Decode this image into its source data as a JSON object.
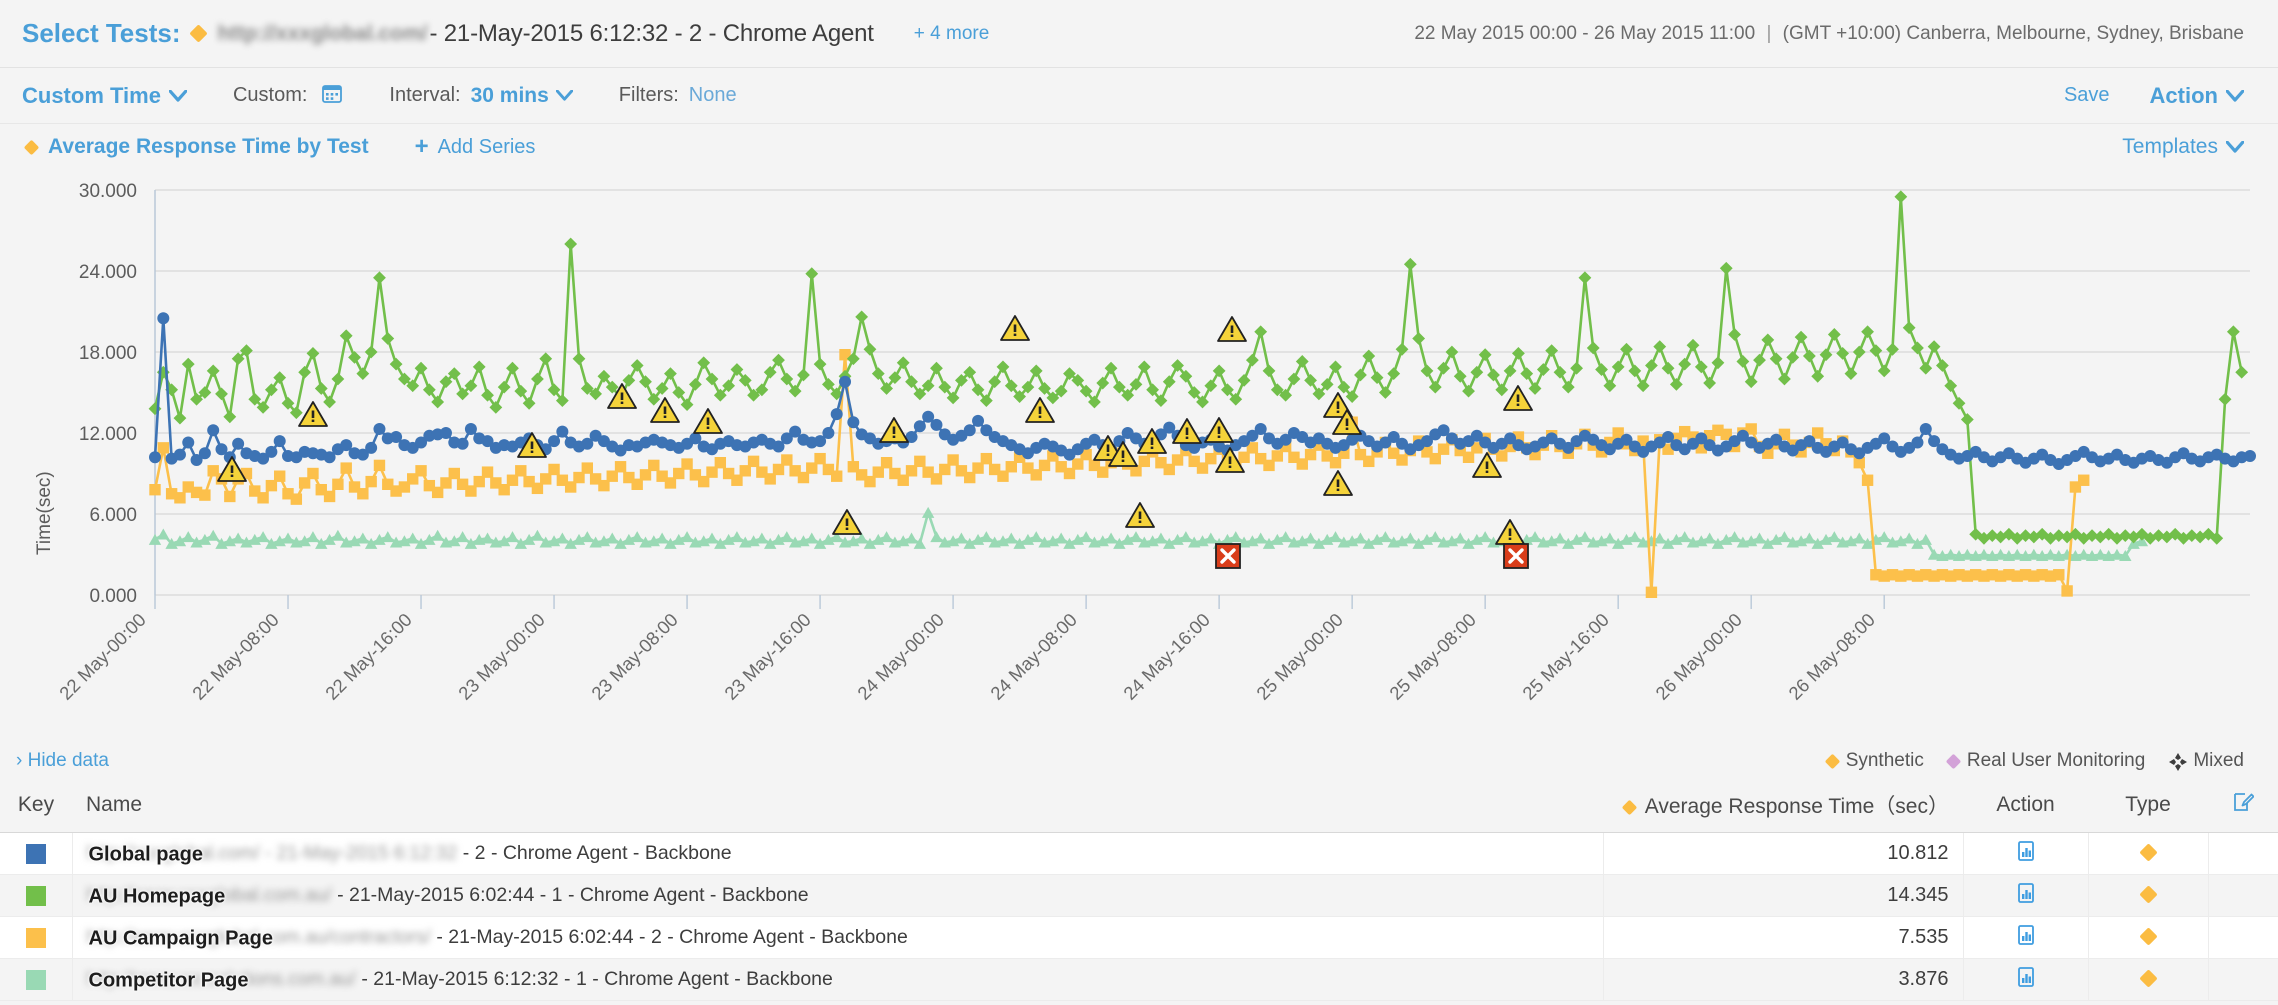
{
  "header": {
    "select_tests_label": "Select Tests:",
    "blurred_url": "http://xxxglobal.com/",
    "title": "- 21-May-2015 6:12:32 - 2 - Chrome Agent",
    "more_link": "+ 4 more",
    "date_range": "22 May 2015 00:00 - 26 May 2015 11:00",
    "separator": "|",
    "timezone": "(GMT +10:00) Canberra, Melbourne, Sydney, Brisbane"
  },
  "toolbar": {
    "time_mode": "Custom Time",
    "custom_label": "Custom:",
    "calendar_icon": "calendar-icon",
    "interval_label": "Interval:",
    "interval_value": "30 mins",
    "filters_label": "Filters:",
    "filters_value": "None",
    "save_label": "Save",
    "action_label": "Action",
    "caret": "⌄"
  },
  "series_bar": {
    "series_name": "Average Response Time by Test",
    "add_series": "Add Series",
    "templates": "Templates"
  },
  "chart_data": {
    "type": "line",
    "title": "Average Response Time by Test",
    "xlabel": "",
    "ylabel": "Time(sec)",
    "ylim": [
      0,
      30
    ],
    "yticks": [
      "0.000",
      "6.000",
      "12.000",
      "18.000",
      "24.000",
      "30.000"
    ],
    "grid": true,
    "legend_position": "below-table",
    "xticks": [
      "22 May-00:00",
      "22 May-08:00",
      "22 May-16:00",
      "23 May-00:00",
      "23 May-08:00",
      "23 May-16:00",
      "24 May-00:00",
      "24 May-08:00",
      "24 May-16:00",
      "25 May-00:00",
      "25 May-08:00",
      "25 May-16:00",
      "26 May-00:00",
      "26 May-08:00"
    ],
    "x_start": "22 May 2015 00:00",
    "x_end": "26 May 2015 11:00",
    "interval": "30 mins",
    "series": [
      {
        "name": "Global page",
        "color": "#3d73b4",
        "marker": "circle",
        "average": 10.812,
        "values": [
          10.2,
          20.5,
          10.1,
          10.4,
          11.3,
          10.0,
          10.5,
          12.2,
          10.8,
          10.2,
          11.2,
          10.5,
          10.3,
          10.1,
          10.6,
          11.4,
          10.3,
          10.2,
          10.6,
          10.5,
          10.4,
          10.2,
          10.8,
          11.1,
          10.5,
          10.4,
          10.9,
          12.3,
          11.6,
          11.7,
          11.1,
          10.9,
          11.3,
          11.8,
          11.9,
          12.0,
          11.3,
          11.2,
          12.3,
          11.6,
          11.4,
          10.9,
          11.1,
          11.0,
          11.3,
          11.6,
          11.1,
          10.8,
          11.4,
          12.1,
          11.3,
          11.0,
          11.2,
          11.8,
          11.4,
          11.0,
          10.7,
          11.1,
          11.0,
          11.3,
          11.5,
          11.3,
          11.1,
          10.9,
          11.2,
          11.6,
          11.0,
          10.8,
          11.2,
          11.4,
          11.1,
          11.0,
          11.3,
          11.5,
          11.2,
          11.0,
          11.6,
          12.1,
          11.5,
          11.3,
          11.4,
          12.0,
          13.4,
          15.8,
          12.8,
          11.9,
          11.6,
          11.2,
          11.4,
          11.6,
          11.3,
          11.7,
          12.5,
          13.2,
          12.6,
          11.9,
          11.5,
          11.8,
          12.2,
          12.9,
          12.2,
          11.7,
          11.4,
          11.1,
          10.8,
          10.5,
          10.9,
          11.2,
          11.0,
          10.7,
          10.4,
          10.8,
          11.2,
          11.5,
          11.1,
          10.8,
          11.4,
          12.0,
          11.6,
          11.2,
          11.5,
          11.9,
          12.4,
          11.8,
          11.1,
          10.9,
          11.3,
          11.5,
          11.0,
          10.7,
          11.1,
          11.4,
          11.8,
          12.3,
          11.6,
          11.2,
          11.5,
          12.0,
          11.7,
          11.3,
          11.6,
          11.2,
          10.9,
          11.1,
          11.5,
          11.8,
          11.4,
          11.0,
          11.3,
          11.7,
          11.2,
          10.8,
          11.1,
          11.4,
          11.9,
          12.2,
          11.6,
          11.2,
          11.4,
          11.8,
          11.3,
          10.9,
          11.2,
          11.6,
          11.1,
          10.8,
          11.0,
          11.3,
          11.6,
          11.2,
          10.9,
          11.4,
          11.8,
          11.5,
          11.1,
          10.8,
          11.2,
          11.5,
          11.0,
          10.6,
          11.0,
          11.3,
          11.7,
          11.1,
          10.8,
          11.2,
          11.6,
          11.1,
          10.7,
          11.0,
          11.4,
          11.8,
          11.3,
          10.9,
          11.2,
          11.5,
          11.0,
          10.7,
          11.1,
          11.4,
          10.9,
          10.6,
          11.0,
          11.3,
          10.8,
          10.5,
          10.9,
          11.2,
          11.6,
          11.0,
          10.6,
          10.9,
          11.3,
          12.3,
          11.4,
          10.8,
          10.4,
          10.1,
          10.3,
          10.6,
          10.2,
          9.9,
          10.2,
          10.5,
          10.1,
          9.8,
          10.1,
          10.4,
          10.0,
          9.7,
          10.0,
          10.3,
          10.6,
          10.2,
          9.9,
          10.1,
          10.4,
          10.0,
          9.8,
          10.1,
          10.3,
          10.0,
          9.8,
          10.2,
          10.5,
          10.1,
          9.9,
          10.2,
          10.4,
          10.1,
          9.9,
          10.2,
          10.3
        ]
      },
      {
        "name": "AU Homepage",
        "color": "#72bf4a",
        "marker": "diamond",
        "average": 14.345,
        "values": [
          13.8,
          16.5,
          15.2,
          13.1,
          17.1,
          14.5,
          15.0,
          16.6,
          14.9,
          13.2,
          17.5,
          18.1,
          14.5,
          13.9,
          15.2,
          16.1,
          14.2,
          13.5,
          16.5,
          17.9,
          15.3,
          14.3,
          16.0,
          19.2,
          17.6,
          16.4,
          18.0,
          23.5,
          19.0,
          17.1,
          16.0,
          15.5,
          16.8,
          15.2,
          14.3,
          15.8,
          16.4,
          14.9,
          15.5,
          16.9,
          14.8,
          13.9,
          15.4,
          16.8,
          15.1,
          14.2,
          16.0,
          17.5,
          15.2,
          14.4,
          26.0,
          17.5,
          15.3,
          14.9,
          16.2,
          15.4,
          14.6,
          15.9,
          17.0,
          15.8,
          14.5,
          15.3,
          16.4,
          15.0,
          14.1,
          15.6,
          17.2,
          16.0,
          14.8,
          15.5,
          16.7,
          15.9,
          14.8,
          15.2,
          16.5,
          17.4,
          16.0,
          15.1,
          16.3,
          23.8,
          17.1,
          15.6,
          14.9,
          16.2,
          17.5,
          20.6,
          18.2,
          16.4,
          15.3,
          16.1,
          17.2,
          15.8,
          14.9,
          15.5,
          16.8,
          15.4,
          14.6,
          15.9,
          16.5,
          15.2,
          14.4,
          15.8,
          16.9,
          15.5,
          14.7,
          15.4,
          16.6,
          15.3,
          14.6,
          15.1,
          16.4,
          15.9,
          15.1,
          14.3,
          15.7,
          16.8,
          15.4,
          14.8,
          15.6,
          16.9,
          15.2,
          14.4,
          15.8,
          17.0,
          16.2,
          15.0,
          14.3,
          15.5,
          16.6,
          15.2,
          14.5,
          15.9,
          17.4,
          19.5,
          16.6,
          15.2,
          14.8,
          16.0,
          17.3,
          15.9,
          14.9,
          15.6,
          16.9,
          15.4,
          14.7,
          16.3,
          17.7,
          16.1,
          15.0,
          16.4,
          18.2,
          24.5,
          19.0,
          16.6,
          15.4,
          16.8,
          18.0,
          16.2,
          15.1,
          16.5,
          17.8,
          16.3,
          15.2,
          16.6,
          17.9,
          16.4,
          15.3,
          16.7,
          18.1,
          16.5,
          15.4,
          16.8,
          23.5,
          18.3,
          16.7,
          15.5,
          16.9,
          18.2,
          16.6,
          15.5,
          17.0,
          18.4,
          16.8,
          15.6,
          17.1,
          18.5,
          16.9,
          15.7,
          17.2,
          24.2,
          19.3,
          17.3,
          15.8,
          17.4,
          18.9,
          17.5,
          16.0,
          17.6,
          19.1,
          17.7,
          16.2,
          17.8,
          19.3,
          17.9,
          16.4,
          18.0,
          19.5,
          18.1,
          16.6,
          18.2,
          29.5,
          19.8,
          18.3,
          16.8,
          18.4,
          17.0,
          15.5,
          14.2,
          13.0,
          4.5,
          4.2,
          4.4,
          4.3,
          4.5,
          4.2,
          4.4,
          4.3,
          4.5,
          4.2,
          4.4,
          4.3,
          4.5,
          4.2,
          4.4,
          4.3,
          4.5,
          4.2,
          4.4,
          4.3,
          4.5,
          4.2,
          4.4,
          4.3,
          4.5,
          4.2,
          4.4,
          4.3,
          4.5,
          4.2,
          14.5,
          19.5,
          16.5
        ]
      },
      {
        "name": "AU Campaign Page",
        "color": "#fcc04b",
        "marker": "square",
        "average": 7.535,
        "values": [
          7.8,
          10.9,
          7.5,
          7.2,
          8.0,
          7.6,
          7.4,
          9.2,
          8.6,
          7.3,
          8.6,
          9.0,
          7.7,
          7.2,
          8.1,
          8.8,
          7.5,
          7.1,
          8.3,
          9.0,
          7.8,
          7.3,
          8.2,
          9.4,
          8.0,
          7.5,
          8.4,
          9.6,
          8.2,
          7.7,
          8.0,
          8.6,
          9.2,
          8.1,
          7.6,
          8.3,
          9.0,
          8.2,
          7.7,
          8.4,
          9.1,
          8.3,
          7.8,
          8.5,
          9.2,
          8.4,
          7.9,
          8.6,
          9.3,
          8.5,
          8.0,
          8.7,
          9.4,
          8.6,
          8.1,
          8.8,
          9.5,
          8.7,
          8.2,
          8.9,
          9.6,
          8.8,
          8.3,
          9.0,
          9.7,
          8.9,
          8.4,
          9.1,
          9.8,
          9.0,
          8.5,
          9.2,
          9.9,
          9.1,
          8.6,
          9.3,
          10.0,
          9.2,
          8.7,
          9.4,
          10.1,
          9.3,
          8.8,
          17.8,
          9.5,
          8.9,
          8.4,
          9.1,
          9.8,
          9.0,
          8.5,
          9.2,
          9.9,
          9.1,
          8.6,
          9.3,
          10.0,
          9.2,
          8.7,
          9.4,
          10.1,
          9.3,
          8.8,
          9.5,
          10.2,
          9.4,
          8.9,
          9.6,
          10.3,
          9.5,
          9.0,
          9.7,
          10.4,
          9.6,
          9.1,
          9.8,
          10.5,
          9.7,
          9.2,
          9.9,
          10.6,
          9.8,
          9.3,
          10.0,
          10.7,
          9.9,
          9.4,
          10.1,
          10.8,
          10.0,
          9.5,
          10.2,
          10.9,
          10.1,
          9.6,
          10.3,
          11.0,
          10.2,
          9.7,
          10.4,
          11.1,
          10.3,
          9.8,
          10.5,
          12.8,
          10.4,
          9.9,
          10.6,
          11.3,
          10.5,
          10.0,
          10.7,
          11.4,
          10.6,
          10.1,
          10.8,
          11.5,
          10.7,
          10.2,
          10.9,
          11.6,
          10.8,
          10.3,
          11.0,
          11.7,
          10.9,
          10.4,
          11.1,
          11.8,
          11.0,
          10.5,
          11.2,
          11.9,
          11.1,
          10.6,
          11.3,
          12.0,
          11.2,
          10.7,
          11.4,
          0.2,
          11.5,
          10.8,
          11.6,
          12.1,
          11.7,
          10.9,
          11.8,
          12.2,
          11.9,
          11.0,
          12.0,
          12.3,
          11.0,
          10.5,
          11.2,
          11.9,
          11.1,
          10.6,
          11.3,
          12.0,
          11.2,
          10.7,
          11.4,
          10.6,
          9.8,
          8.5,
          1.5,
          1.4,
          1.5,
          1.4,
          1.5,
          1.4,
          1.5,
          1.4,
          1.5,
          1.4,
          1.5,
          1.4,
          1.5,
          1.4,
          1.5,
          1.4,
          1.5,
          1.4,
          1.5,
          1.4,
          1.5,
          1.4,
          1.5,
          0.3,
          8.0,
          8.5
        ]
      },
      {
        "name": "Competitor Page",
        "color": "#99d9b4",
        "marker": "triangle",
        "average": 3.876,
        "values": [
          4.1,
          4.5,
          3.8,
          4.0,
          4.3,
          3.9,
          4.1,
          4.4,
          3.8,
          4.0,
          4.2,
          3.9,
          4.1,
          4.3,
          3.8,
          4.0,
          4.2,
          3.9,
          4.0,
          4.3,
          3.8,
          4.1,
          4.4,
          3.9,
          4.0,
          4.2,
          3.8,
          4.1,
          4.3,
          3.9,
          4.0,
          4.2,
          3.8,
          4.1,
          4.4,
          3.9,
          4.0,
          4.3,
          3.8,
          4.1,
          4.2,
          3.9,
          4.0,
          4.3,
          3.8,
          4.1,
          4.4,
          3.9,
          4.0,
          4.2,
          3.8,
          4.1,
          4.3,
          3.9,
          4.0,
          4.2,
          3.8,
          4.1,
          4.3,
          3.9,
          4.0,
          4.2,
          3.8,
          4.1,
          4.3,
          3.9,
          4.0,
          4.2,
          3.8,
          4.1,
          4.3,
          3.9,
          4.0,
          4.2,
          3.8,
          4.1,
          4.3,
          3.9,
          4.0,
          4.2,
          3.8,
          4.1,
          4.3,
          3.9,
          4.0,
          4.2,
          3.8,
          4.1,
          4.3,
          3.9,
          4.0,
          4.2,
          3.8,
          6.1,
          4.3,
          3.9,
          4.0,
          4.2,
          3.8,
          4.1,
          4.3,
          3.9,
          4.0,
          4.2,
          3.8,
          4.1,
          4.3,
          3.9,
          4.0,
          4.2,
          3.8,
          4.1,
          4.3,
          3.9,
          4.0,
          4.2,
          3.8,
          4.1,
          4.3,
          3.9,
          4.0,
          4.2,
          3.8,
          4.1,
          4.3,
          3.9,
          4.0,
          4.2,
          3.8,
          4.1,
          4.3,
          3.9,
          4.0,
          4.2,
          3.8,
          4.1,
          4.3,
          3.9,
          4.0,
          4.2,
          3.8,
          4.1,
          4.3,
          3.9,
          4.0,
          4.2,
          3.8,
          4.1,
          4.3,
          3.9,
          4.0,
          4.2,
          3.8,
          4.1,
          4.3,
          3.9,
          4.0,
          4.2,
          3.8,
          4.1,
          4.3,
          3.9,
          4.0,
          4.2,
          3.8,
          4.1,
          4.3,
          3.9,
          4.0,
          4.2,
          3.8,
          4.1,
          4.3,
          3.9,
          4.0,
          4.2,
          3.8,
          4.1,
          4.3,
          3.9,
          4.0,
          4.2,
          3.8,
          4.1,
          4.3,
          3.9,
          4.0,
          4.2,
          3.8,
          4.1,
          4.3,
          3.9,
          4.0,
          4.2,
          3.8,
          4.1,
          4.3,
          3.9,
          4.0,
          4.2,
          3.8,
          4.1,
          4.3,
          3.9,
          4.0,
          4.2,
          3.8,
          4.1,
          4.3,
          3.9,
          4.0,
          4.2,
          3.8,
          4.1,
          3.0,
          2.9,
          3.0,
          2.9,
          3.0,
          2.9,
          3.0,
          2.9,
          3.0,
          2.9,
          3.0,
          2.9,
          3.0,
          2.9,
          3.0,
          2.9,
          3.0,
          2.9,
          3.0,
          2.9,
          3.0,
          2.9,
          3.0,
          2.9,
          3.8,
          4.0
        ]
      }
    ],
    "annotations": {
      "warning_icon": "warning-triangle-icon",
      "error_icon": "error-x-icon",
      "warning_count": 22,
      "error_count": 2
    }
  },
  "below_chart": {
    "hide_data": "› Hide data",
    "legend": [
      {
        "label": "Synthetic",
        "icon": "synthetic-diamond-icon",
        "color": "#fbbc42"
      },
      {
        "label": "Real User Monitoring",
        "icon": "rum-diamond-icon",
        "color": "#d3a2d8"
      },
      {
        "label": "Mixed",
        "icon": "mixed-icon",
        "color": "#3d3d3d"
      }
    ]
  },
  "table": {
    "columns": [
      "Key",
      "Name",
      "Average Response Time（sec）",
      "Action",
      "Type",
      ""
    ],
    "edit_icon": "edit-columns-icon",
    "rows": [
      {
        "color": "#3d73b4",
        "tag": "Global page",
        "blurred_url": "http://xxxglobal.com/ - 21-May-2015 6:12:32",
        "rest": "- 2 - Chrome Agent - Backbone",
        "avg": "10.812",
        "action_icon": "bar-chart-icon",
        "type_icon": "synthetic-diamond-icon"
      },
      {
        "color": "#72bf4a",
        "tag": "AU Homepage",
        "blurred_url": "http://www.xxxglobal.com.au/",
        "rest": "- 21-May-2015 6:02:44 - 1 - Chrome Agent - Backbone",
        "avg": "14.345",
        "action_icon": "bar-chart-icon",
        "type_icon": "synthetic-diamond-icon"
      },
      {
        "color": "#fcc04b",
        "tag": "AU Campaign Page",
        "blurred_url": "http://www.xxxglobal.com.au/contractors/",
        "rest": "- 21-May-2015 6:02:44 - 2 - Chrome Agent - Backbone",
        "avg": "7.535",
        "action_icon": "bar-chart-icon",
        "type_icon": "synthetic-diamond-icon"
      },
      {
        "color": "#99d9b4",
        "tag": "Competitor Page",
        "blurred_url": "http://www.xxxsolutions.com.au/",
        "rest": "- 21-May-2015 6:12:32 - 1 - Chrome Agent - Backbone",
        "avg": "3.876",
        "action_icon": "bar-chart-icon",
        "type_icon": "synthetic-diamond-icon"
      }
    ]
  }
}
